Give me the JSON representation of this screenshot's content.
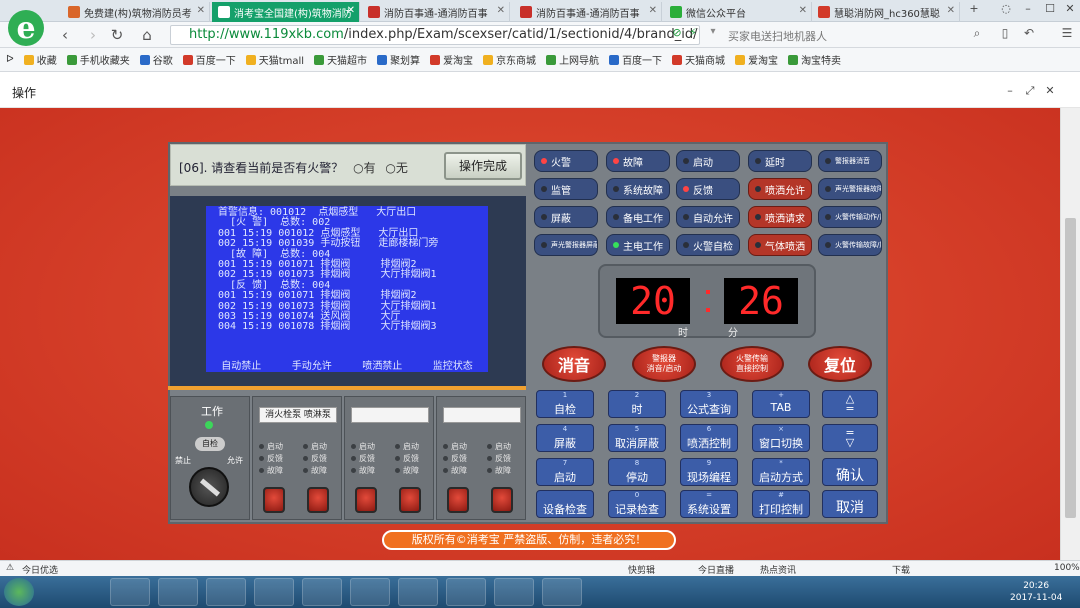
{
  "tabs": [
    {
      "label": "免费建(构)筑物消防员考",
      "color": "#d9662a"
    },
    {
      "label": "消考宝全国建(构)筑物消防",
      "color": "#ffffff",
      "active": true
    },
    {
      "label": "消防百事通-通消防百事",
      "color": "#c8302a"
    },
    {
      "label": "消防百事通-通消防百事",
      "color": "#c8302a"
    },
    {
      "label": "微信公众平台",
      "color": "#2aae3a"
    },
    {
      "label": "慧聪消防网_hc360慧聪",
      "color": "#d23a2a"
    }
  ],
  "address": {
    "url_host": "http://www.119xkb.com",
    "url_path": "/index.php/Exam/scexser/catid/1/sectionid/4/brand_id/1",
    "search": "买家电送扫地机器人"
  },
  "bookmarks": [
    "收藏",
    "手机收藏夹",
    "谷歌",
    "百度一下",
    "天猫tmall",
    "天猫超市",
    "聚划算",
    "爱淘宝",
    "京东商城",
    "上网导航",
    "百度一下",
    "天猫商城",
    "爱淘宝",
    "淘宝特卖"
  ],
  "dialog": {
    "title": "操作"
  },
  "question": {
    "text": "[06]. 请查看当前是否有火警？",
    "opt_yes": "有",
    "opt_no": "无",
    "done": "操作完成"
  },
  "screen": {
    "lines": [
      "首警信息: 001012  点烟感型   大厅出口",
      "  [火 警]  总数: 002",
      "001 15:19 001012 点烟感型   大厅出口",
      "002 15:19 001039 手动按钮   走廊楼梯门旁",
      "  [故 障]  总数: 004",
      "001 15:19 001071 排烟阀     排烟阀2",
      "002 15:19 001073 排烟阀     大厅排烟阀1",
      "  [反 馈]  总数: 004",
      "001 15:19 001071 排烟阀     排烟阀2",
      "002 15:19 001073 排烟阀     大厅排烟阀1",
      "003 15:19 001074 送风阀     大厅",
      "004 15:19 001078 排烟阀     大厅排烟阀3"
    ],
    "footer": [
      "自动禁止",
      "手动允许",
      "喷洒禁止",
      "监控状态"
    ]
  },
  "work": {
    "label": "工作",
    "self_check": "自检",
    "left": "禁止",
    "right": "允许"
  },
  "zones": [
    {
      "name": "消火栓泵 喷淋泵"
    },
    {
      "name": ""
    },
    {
      "name": ""
    }
  ],
  "zone_leds": [
    "启动",
    "反馈",
    "故障"
  ],
  "status_buttons": [
    {
      "label": "火警",
      "led": "on"
    },
    {
      "label": "故障",
      "led": "on"
    },
    {
      "label": "启动",
      "led": "off"
    },
    {
      "label": "延时",
      "led": "off"
    },
    {
      "label": "警报器消音",
      "led": "off",
      "small": true
    },
    {
      "label": "监管",
      "led": "off"
    },
    {
      "label": "系统故障",
      "led": "off"
    },
    {
      "label": "反馈",
      "led": "on"
    },
    {
      "label": "喷洒允许",
      "led": "off",
      "red": true
    },
    {
      "label": "声光警报器故障",
      "led": "off",
      "small": true
    },
    {
      "label": "屏蔽",
      "led": "off"
    },
    {
      "label": "备电工作",
      "led": "off"
    },
    {
      "label": "自动允许",
      "led": "off"
    },
    {
      "label": "喷洒请求",
      "led": "off",
      "red": true
    },
    {
      "label": "火警传输动作/反馈",
      "led": "off",
      "small": true
    },
    {
      "label": "声光警报器屏蔽",
      "led": "off",
      "small": true
    },
    {
      "label": "主电工作",
      "led": "green"
    },
    {
      "label": "火警自检",
      "led": "off"
    },
    {
      "label": "气体喷洒",
      "led": "off",
      "red": true
    },
    {
      "label": "火警传输故障/屏蔽",
      "led": "off",
      "small": true
    }
  ],
  "clock": {
    "hour": "20",
    "minute": "26",
    "hour_label": "时",
    "minute_label": "分"
  },
  "controls": [
    {
      "label": "消音"
    },
    {
      "label": "警报器\n消音/启动",
      "small": true
    },
    {
      "label": "火警传输\n直接控制",
      "small": true
    },
    {
      "label": "复位"
    }
  ],
  "keys": [
    {
      "n": "1",
      "label": "自检"
    },
    {
      "n": "2",
      "label": "时"
    },
    {
      "n": "3",
      "label": "公式查询"
    },
    {
      "n": "+",
      "label": "TAB"
    },
    {
      "n": "",
      "label": "△\n=",
      "big": true
    },
    {
      "n": "4",
      "label": "屏蔽"
    },
    {
      "n": "5",
      "label": "取消屏蔽"
    },
    {
      "n": "6",
      "label": "喷洒控制"
    },
    {
      "n": "×",
      "label": "窗口切换"
    },
    {
      "n": "",
      "label": "=\n▽",
      "big": true
    },
    {
      "n": "7",
      "label": "启动"
    },
    {
      "n": "8",
      "label": "停动"
    },
    {
      "n": "9",
      "label": "现场编程"
    },
    {
      "n": "*",
      "label": "启动方式"
    },
    {
      "n": "",
      "label": "确认",
      "big": true
    },
    {
      "n": "",
      "label": "设备检查"
    },
    {
      "n": "0",
      "label": "记录检查"
    },
    {
      "n": "=",
      "label": "系统设置"
    },
    {
      "n": "#",
      "label": "打印控制"
    },
    {
      "n": "",
      "label": "取消",
      "big": true
    }
  ],
  "copyright": "版权所有©消考宝 严禁盗版、仿制，违者必究！",
  "status": {
    "left": "今日优选",
    "items": [
      "快剪辑",
      "今日直播",
      "热点资讯",
      "下载"
    ],
    "zoom": "100%"
  },
  "taskbar": {
    "time": "20:26",
    "date": "2017-11-04"
  }
}
